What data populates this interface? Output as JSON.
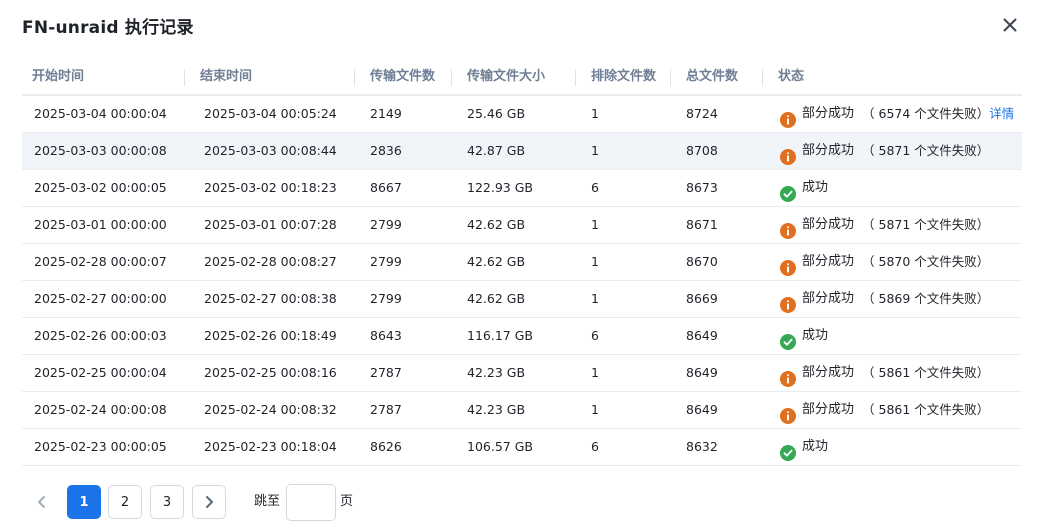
{
  "dialog": {
    "title": "FN-unraid 执行记录"
  },
  "table": {
    "columns": [
      "开始时间",
      "结束时间",
      "传输文件数",
      "传输文件大小",
      "排除文件数",
      "总文件数",
      "状态"
    ],
    "rows": [
      {
        "start": "2025-03-04 00:00:04",
        "end": "2025-03-04 00:05:24",
        "transferred": "2149",
        "size": "25.46 GB",
        "excluded": "1",
        "total": "8724",
        "status": "部分成功",
        "failed": "（ 6574 个文件失败）",
        "detail": "详情",
        "kind": "partial"
      },
      {
        "start": "2025-03-03 00:00:08",
        "end": "2025-03-03 00:08:44",
        "transferred": "2836",
        "size": "42.87 GB",
        "excluded": "1",
        "total": "8708",
        "status": "部分成功",
        "failed": "（ 5871 个文件失败）",
        "detail": "",
        "kind": "partial"
      },
      {
        "start": "2025-03-02 00:00:05",
        "end": "2025-03-02 00:18:23",
        "transferred": "8667",
        "size": "122.93 GB",
        "excluded": "6",
        "total": "8673",
        "status": "成功",
        "failed": "",
        "detail": "",
        "kind": "success"
      },
      {
        "start": "2025-03-01 00:00:00",
        "end": "2025-03-01 00:07:28",
        "transferred": "2799",
        "size": "42.62 GB",
        "excluded": "1",
        "total": "8671",
        "status": "部分成功",
        "failed": "（ 5871 个文件失败）",
        "detail": "",
        "kind": "partial"
      },
      {
        "start": "2025-02-28 00:00:07",
        "end": "2025-02-28 00:08:27",
        "transferred": "2799",
        "size": "42.62 GB",
        "excluded": "1",
        "total": "8670",
        "status": "部分成功",
        "failed": "（ 5870 个文件失败）",
        "detail": "",
        "kind": "partial"
      },
      {
        "start": "2025-02-27 00:00:00",
        "end": "2025-02-27 00:08:38",
        "transferred": "2799",
        "size": "42.62 GB",
        "excluded": "1",
        "total": "8669",
        "status": "部分成功",
        "failed": "（ 5869 个文件失败）",
        "detail": "",
        "kind": "partial"
      },
      {
        "start": "2025-02-26 00:00:03",
        "end": "2025-02-26 00:18:49",
        "transferred": "8643",
        "size": "116.17 GB",
        "excluded": "6",
        "total": "8649",
        "status": "成功",
        "failed": "",
        "detail": "",
        "kind": "success"
      },
      {
        "start": "2025-02-25 00:00:04",
        "end": "2025-02-25 00:08:16",
        "transferred": "2787",
        "size": "42.23 GB",
        "excluded": "1",
        "total": "8649",
        "status": "部分成功",
        "failed": "（ 5861 个文件失败）",
        "detail": "",
        "kind": "partial"
      },
      {
        "start": "2025-02-24 00:00:08",
        "end": "2025-02-24 00:08:32",
        "transferred": "2787",
        "size": "42.23 GB",
        "excluded": "1",
        "total": "8649",
        "status": "部分成功",
        "failed": "（ 5861 个文件失败）",
        "detail": "",
        "kind": "partial"
      },
      {
        "start": "2025-02-23 00:00:05",
        "end": "2025-02-23 00:18:04",
        "transferred": "8626",
        "size": "106.57 GB",
        "excluded": "6",
        "total": "8632",
        "status": "成功",
        "failed": "",
        "detail": "",
        "kind": "success"
      }
    ]
  },
  "pagination": {
    "pages": [
      "1",
      "2",
      "3"
    ],
    "current": "1",
    "jump_label": "跳至",
    "jump_value": "",
    "page_suffix": "页"
  },
  "colors": {
    "accent": "#1a73e8",
    "partial": "#e0701f",
    "success": "#34a853",
    "header_text": "#6f7f96",
    "row_highlight": "#f1f4f9"
  },
  "icons": {
    "close": "close-icon",
    "partial": "warning-circle-icon",
    "success": "check-circle-icon",
    "prev": "chevron-left-icon",
    "next": "chevron-right-icon"
  }
}
